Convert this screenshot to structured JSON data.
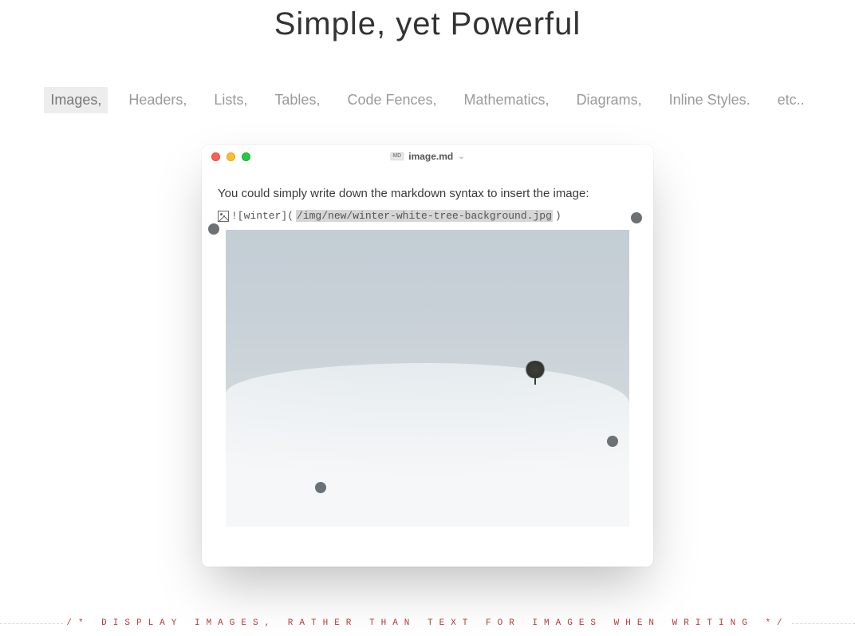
{
  "headline": "Simple, yet Powerful",
  "tabs": [
    {
      "label": "Images,",
      "active": true
    },
    {
      "label": "Headers,",
      "active": false
    },
    {
      "label": "Lists,",
      "active": false
    },
    {
      "label": "Tables,",
      "active": false
    },
    {
      "label": "Code Fences,",
      "active": false
    },
    {
      "label": "Mathematics,",
      "active": false
    },
    {
      "label": "Diagrams,",
      "active": false
    },
    {
      "label": "Inline Styles.",
      "active": false
    },
    {
      "label": "etc..",
      "active": false
    }
  ],
  "window": {
    "file_badge": "md",
    "filename": "image.md",
    "intro": "You could simply write down the markdown syntax to insert the image:",
    "syntax_prefix": "![winter](",
    "syntax_path": "/img/new/winter-white-tree-background.jpg",
    "syntax_suffix": ")"
  },
  "footer": {
    "left_marker": "/*",
    "text": "DISPLAY IMAGES, RATHER THAN TEXT FOR IMAGES WHEN WRITING",
    "right_marker": "*/"
  }
}
